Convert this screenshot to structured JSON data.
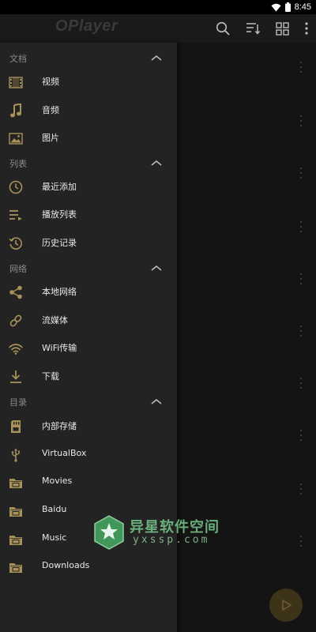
{
  "status_bar": {
    "time": "8:45"
  },
  "app_bar": {
    "title": "OPlayer"
  },
  "drawer": {
    "sections": [
      {
        "title": "文档",
        "items": [
          {
            "label": "视频",
            "icon": "film-icon"
          },
          {
            "label": "音频",
            "icon": "music-note-icon"
          },
          {
            "label": "图片",
            "icon": "picture-icon"
          }
        ]
      },
      {
        "title": "列表",
        "items": [
          {
            "label": "最近添加",
            "icon": "clock-icon"
          },
          {
            "label": "播放列表",
            "icon": "playlist-icon"
          },
          {
            "label": "历史记录",
            "icon": "history-icon"
          }
        ]
      },
      {
        "title": "网络",
        "items": [
          {
            "label": "本地网络",
            "icon": "share-icon"
          },
          {
            "label": "流媒体",
            "icon": "link-icon"
          },
          {
            "label": "WiFi传输",
            "icon": "wifi-icon"
          },
          {
            "label": "下载",
            "icon": "download-icon"
          }
        ]
      },
      {
        "title": "目录",
        "items": [
          {
            "label": "内部存储",
            "icon": "sd-card-icon"
          },
          {
            "label": "VirtualBox",
            "icon": "usb-icon"
          },
          {
            "label": "Movies",
            "icon": "folder-icon"
          },
          {
            "label": "Baidu",
            "icon": "folder-icon"
          },
          {
            "label": "Music",
            "icon": "folder-icon"
          },
          {
            "label": "Downloads",
            "icon": "folder-icon"
          }
        ]
      }
    ]
  },
  "watermark": {
    "title": "异星软件空间",
    "url": "yxssp.com"
  },
  "colors": {
    "accent": "#a8925a",
    "drawer_bg": "#232323",
    "screen_bg": "#151515"
  }
}
